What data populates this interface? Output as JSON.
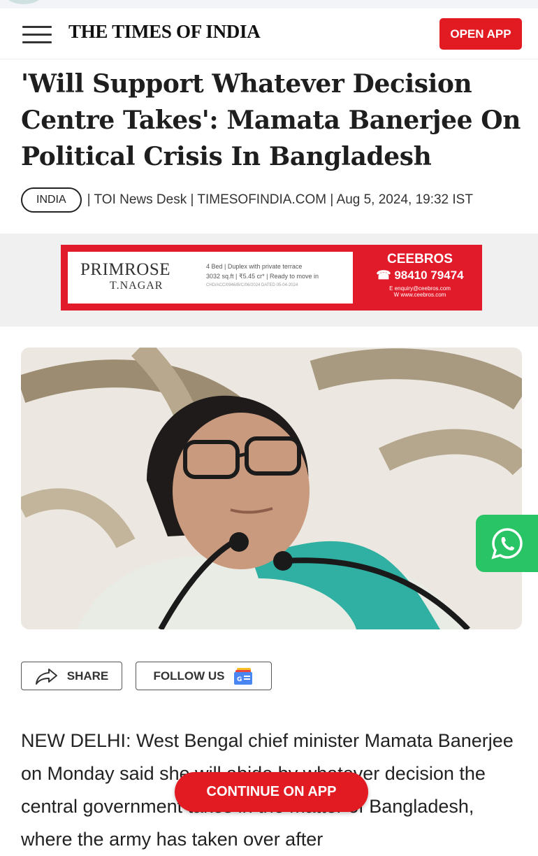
{
  "header": {
    "logo": "THE TIMES OF INDIA",
    "open_app_label": "OPEN APP"
  },
  "article": {
    "headline": "'Will Support Whatever Decision Centre Takes': Mamata Banerjee On Political Crisis In Bangladesh",
    "tag": "INDIA",
    "meta": "| TOI News Desk | TIMESOFINDIA.COM | Aug 5, 2024, 19:32 IST",
    "body": "NEW DELHI: West Bengal chief minister Mamata Banerjee on Monday said she will abide by whatever decision the central government takes in the matter of Bangladesh, where the army has taken over after"
  },
  "ad": {
    "brand": "PRIMROSE",
    "sub": "T.NAGAR",
    "detail_1": "4 Bed | Duplex with private terrace",
    "detail_2": "3032 sq.ft | ₹5.45 cr* | Ready to move in",
    "detail_3": "CHD/ACC/0946/B/C/06/2024 DATED 05-04-2024",
    "advertiser": "CEEBROS",
    "phone": "98410 79474",
    "email": "E enquiry@ceebros.com",
    "web": "W www.ceebros.com"
  },
  "actions": {
    "share_label": "SHARE",
    "follow_label": "FOLLOW US"
  },
  "cta": {
    "continue_label": "CONTINUE ON APP"
  },
  "icons": {
    "menu": "hamburger-icon",
    "share": "share-arrow-icon",
    "follow": "google-news-icon",
    "whatsapp": "whatsapp-icon"
  },
  "colors": {
    "brand_red": "#e21b22",
    "whatsapp_green": "#29c466"
  }
}
